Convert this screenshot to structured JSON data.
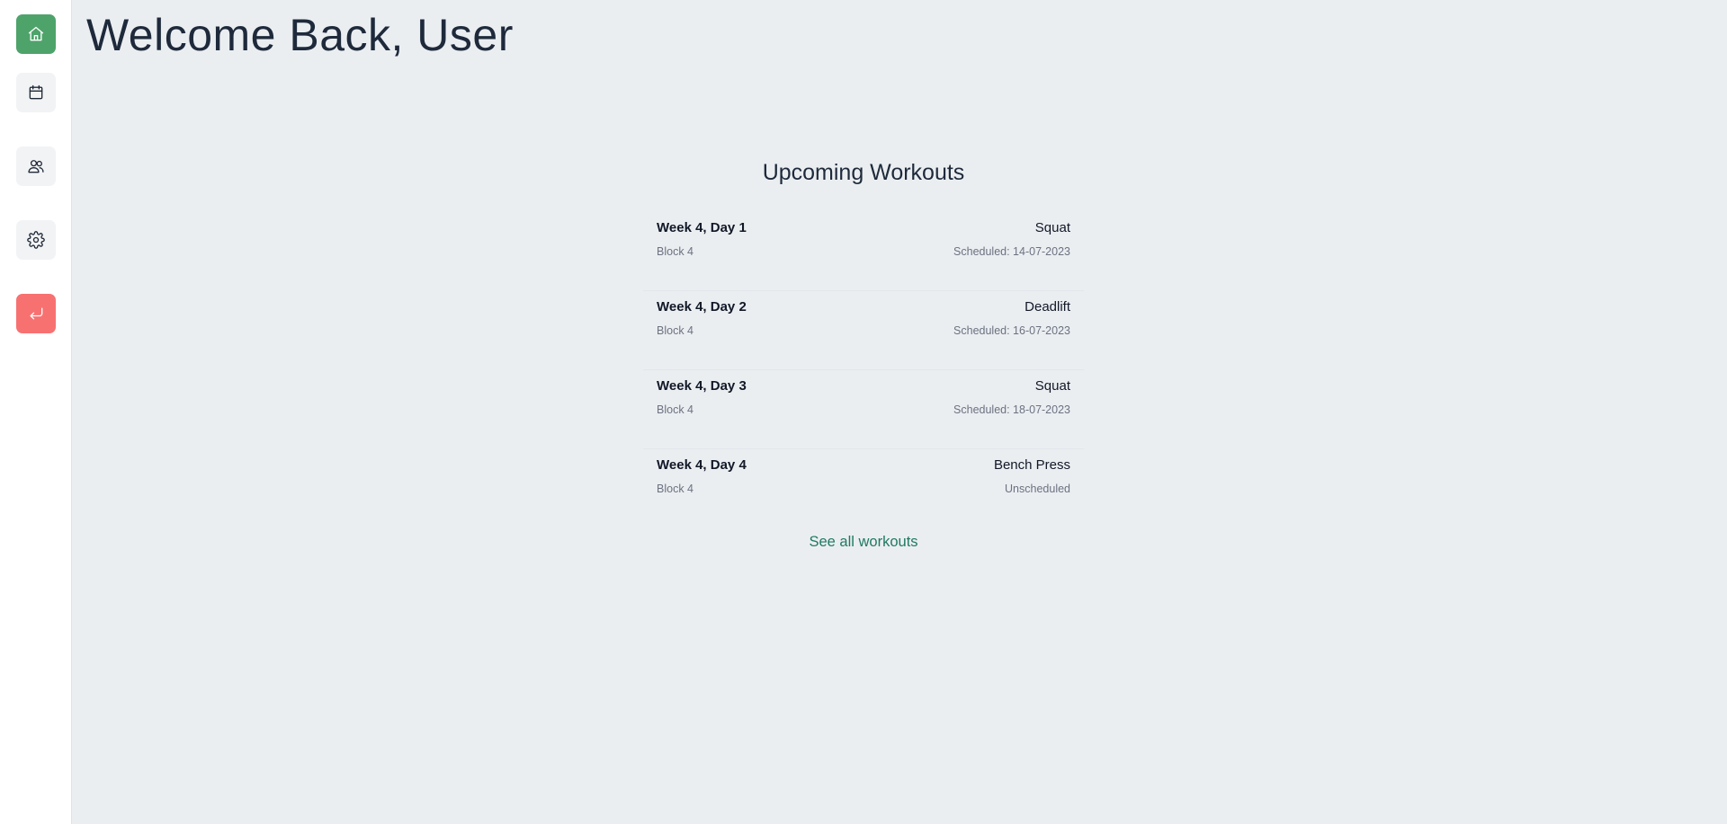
{
  "header": {
    "title": "Welcome Back, User"
  },
  "sidebar": {
    "items": [
      {
        "icon": "home-icon",
        "label": "Home"
      },
      {
        "icon": "calendar-icon",
        "label": "Calendar"
      },
      {
        "icon": "people-icon",
        "label": "People"
      },
      {
        "icon": "gear-icon",
        "label": "Settings"
      },
      {
        "icon": "logout-icon",
        "label": "Log out"
      }
    ],
    "colors": {
      "home_active": "#4ea36a",
      "logout": "#f87171"
    }
  },
  "workouts": {
    "title": "Upcoming Workouts",
    "items": [
      {
        "name": "Week 4, Day 1",
        "block": "Block 4",
        "exercise": "Squat",
        "schedule": "Scheduled: 14-07-2023"
      },
      {
        "name": "Week 4, Day 2",
        "block": "Block 4",
        "exercise": "Deadlift",
        "schedule": "Scheduled: 16-07-2023"
      },
      {
        "name": "Week 4, Day 3",
        "block": "Block 4",
        "exercise": "Squat",
        "schedule": "Scheduled: 18-07-2023"
      },
      {
        "name": "Week 4, Day 4",
        "block": "Block 4",
        "exercise": "Bench Press",
        "schedule": "Unscheduled"
      }
    ],
    "see_all_label": "See all workouts",
    "link_color": "#1f7a63"
  }
}
